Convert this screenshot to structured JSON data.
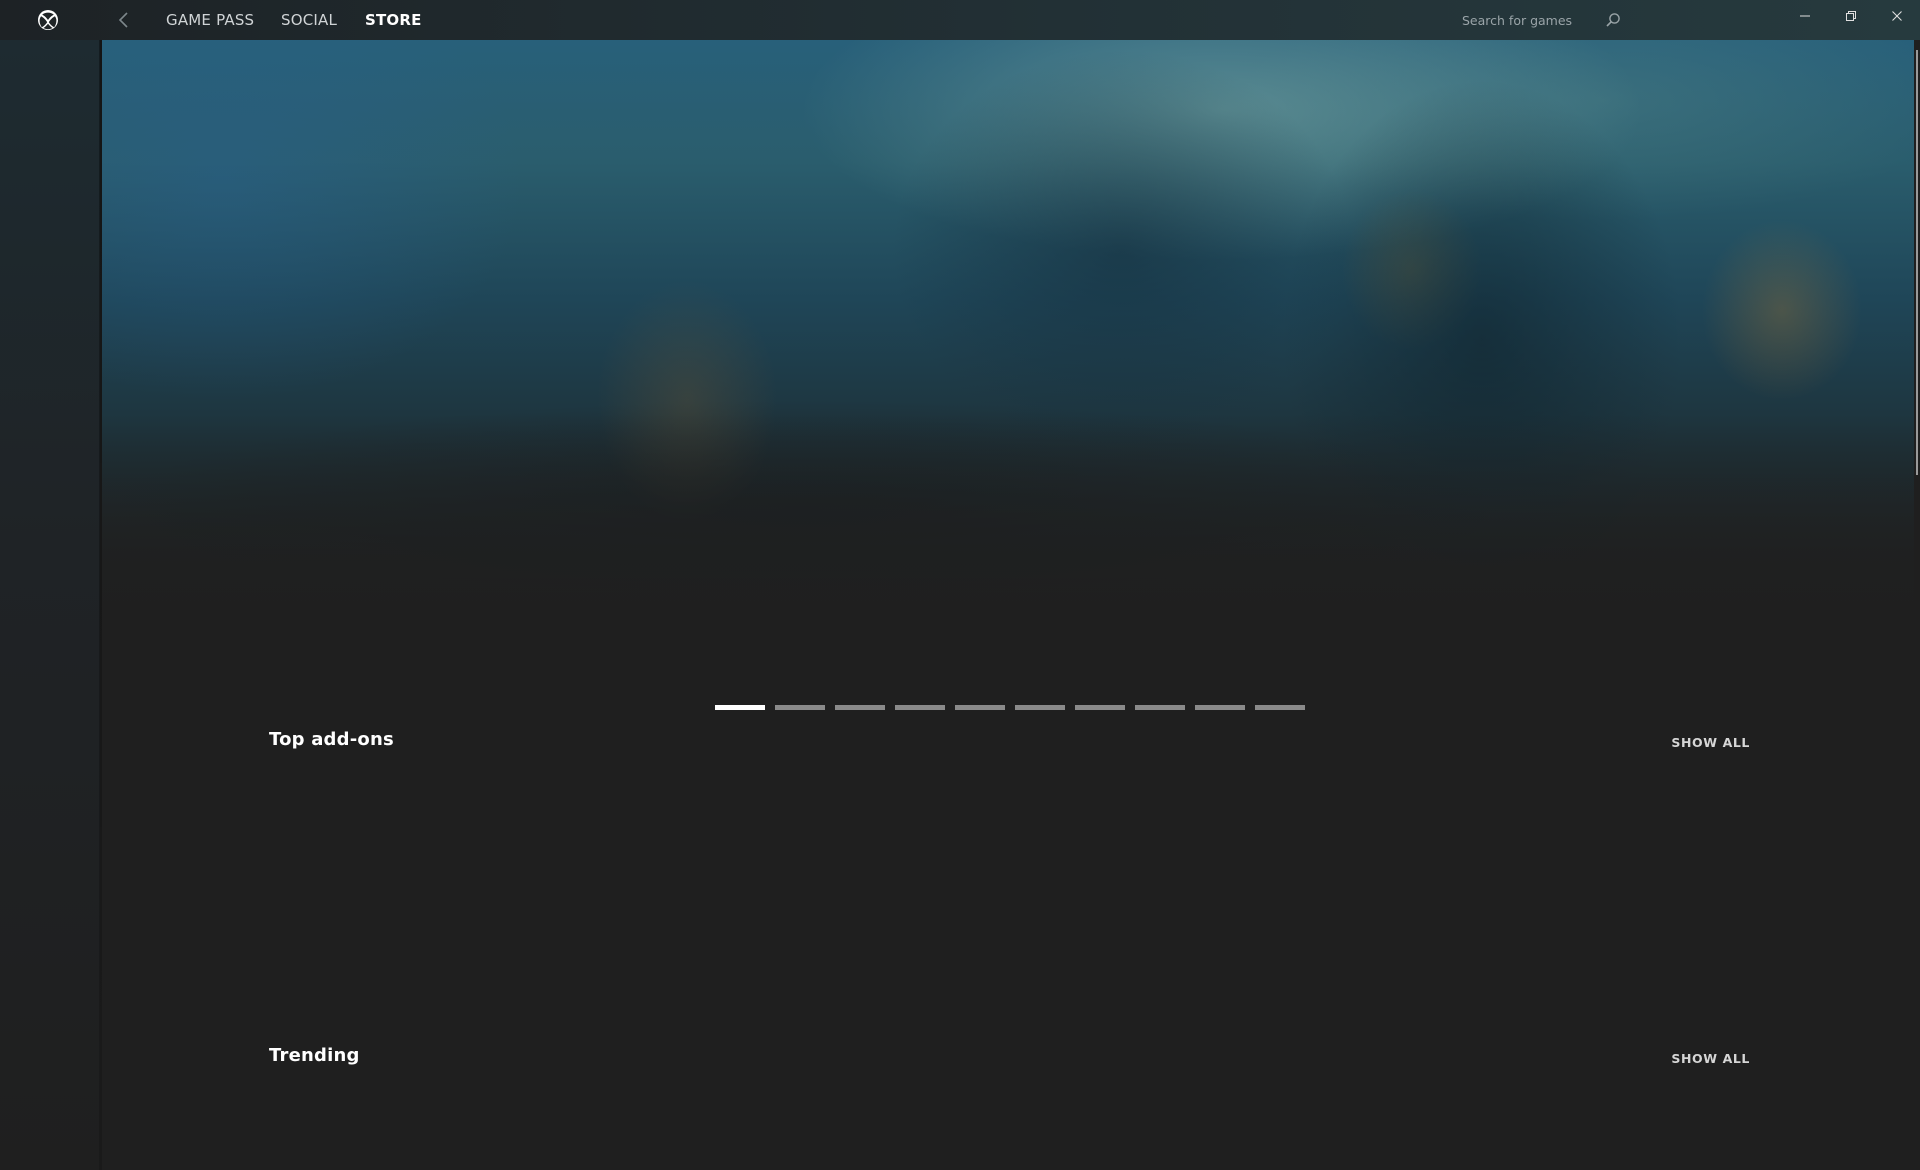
{
  "nav": {
    "tabs": [
      {
        "label": "GAME PASS",
        "active": false
      },
      {
        "label": "SOCIAL",
        "active": false
      },
      {
        "label": "STORE",
        "active": true
      }
    ],
    "logo_icon": "xbox-logo-icon",
    "back_icon": "chevron-left-icon"
  },
  "search": {
    "placeholder": "Search for games",
    "icon": "search-icon"
  },
  "window_controls": {
    "icons": [
      "minimize-icon",
      "restore-icon",
      "close-icon"
    ]
  },
  "carousel": {
    "slide_count": 10,
    "active_index": 0
  },
  "sections": [
    {
      "title": "Top add-ons",
      "show_all_label": "SHOW ALL"
    },
    {
      "title": "Trending",
      "show_all_label": "SHOW ALL"
    }
  ],
  "colors": {
    "background": "#1f1f1f",
    "accent_active": "#ffffff",
    "indicator_inactive": "#8a8a8a"
  }
}
